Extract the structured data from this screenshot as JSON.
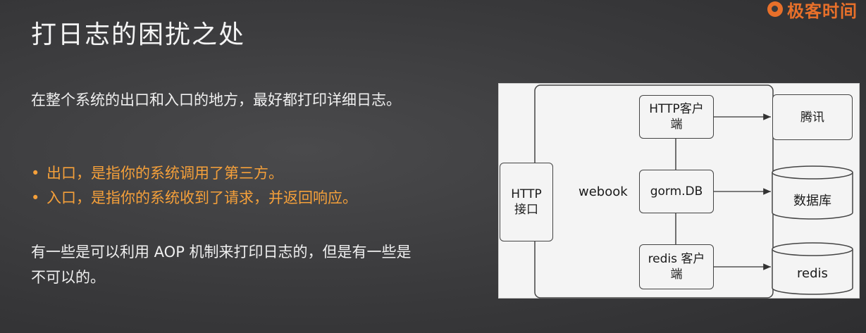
{
  "logo": {
    "text": "极客时间"
  },
  "slide": {
    "title": "打日志的困扰之处",
    "intro": "在整个系统的出口和入口的地方，最好都打印详细日志。",
    "bullets": [
      {
        "marker": "•",
        "text": "出口，是指你的系统调用了第三方。"
      },
      {
        "marker": "•",
        "text": "入口，是指你的系统收到了请求，并返回响应。"
      }
    ],
    "outro": "有一些是可以利用 AOP 机制来打印日志的，但是有一些是不可以的。"
  },
  "diagram": {
    "http_api": "HTTP 接口",
    "webook": "webook",
    "http_client": "HTTP客户端",
    "gorm": "gorm.DB",
    "redis_client": "redis 客户端",
    "tencent": "腾讯",
    "database": "数据库",
    "redis": "redis"
  },
  "colors": {
    "accent": "#f5a03a",
    "background": "#3a3a3c"
  }
}
